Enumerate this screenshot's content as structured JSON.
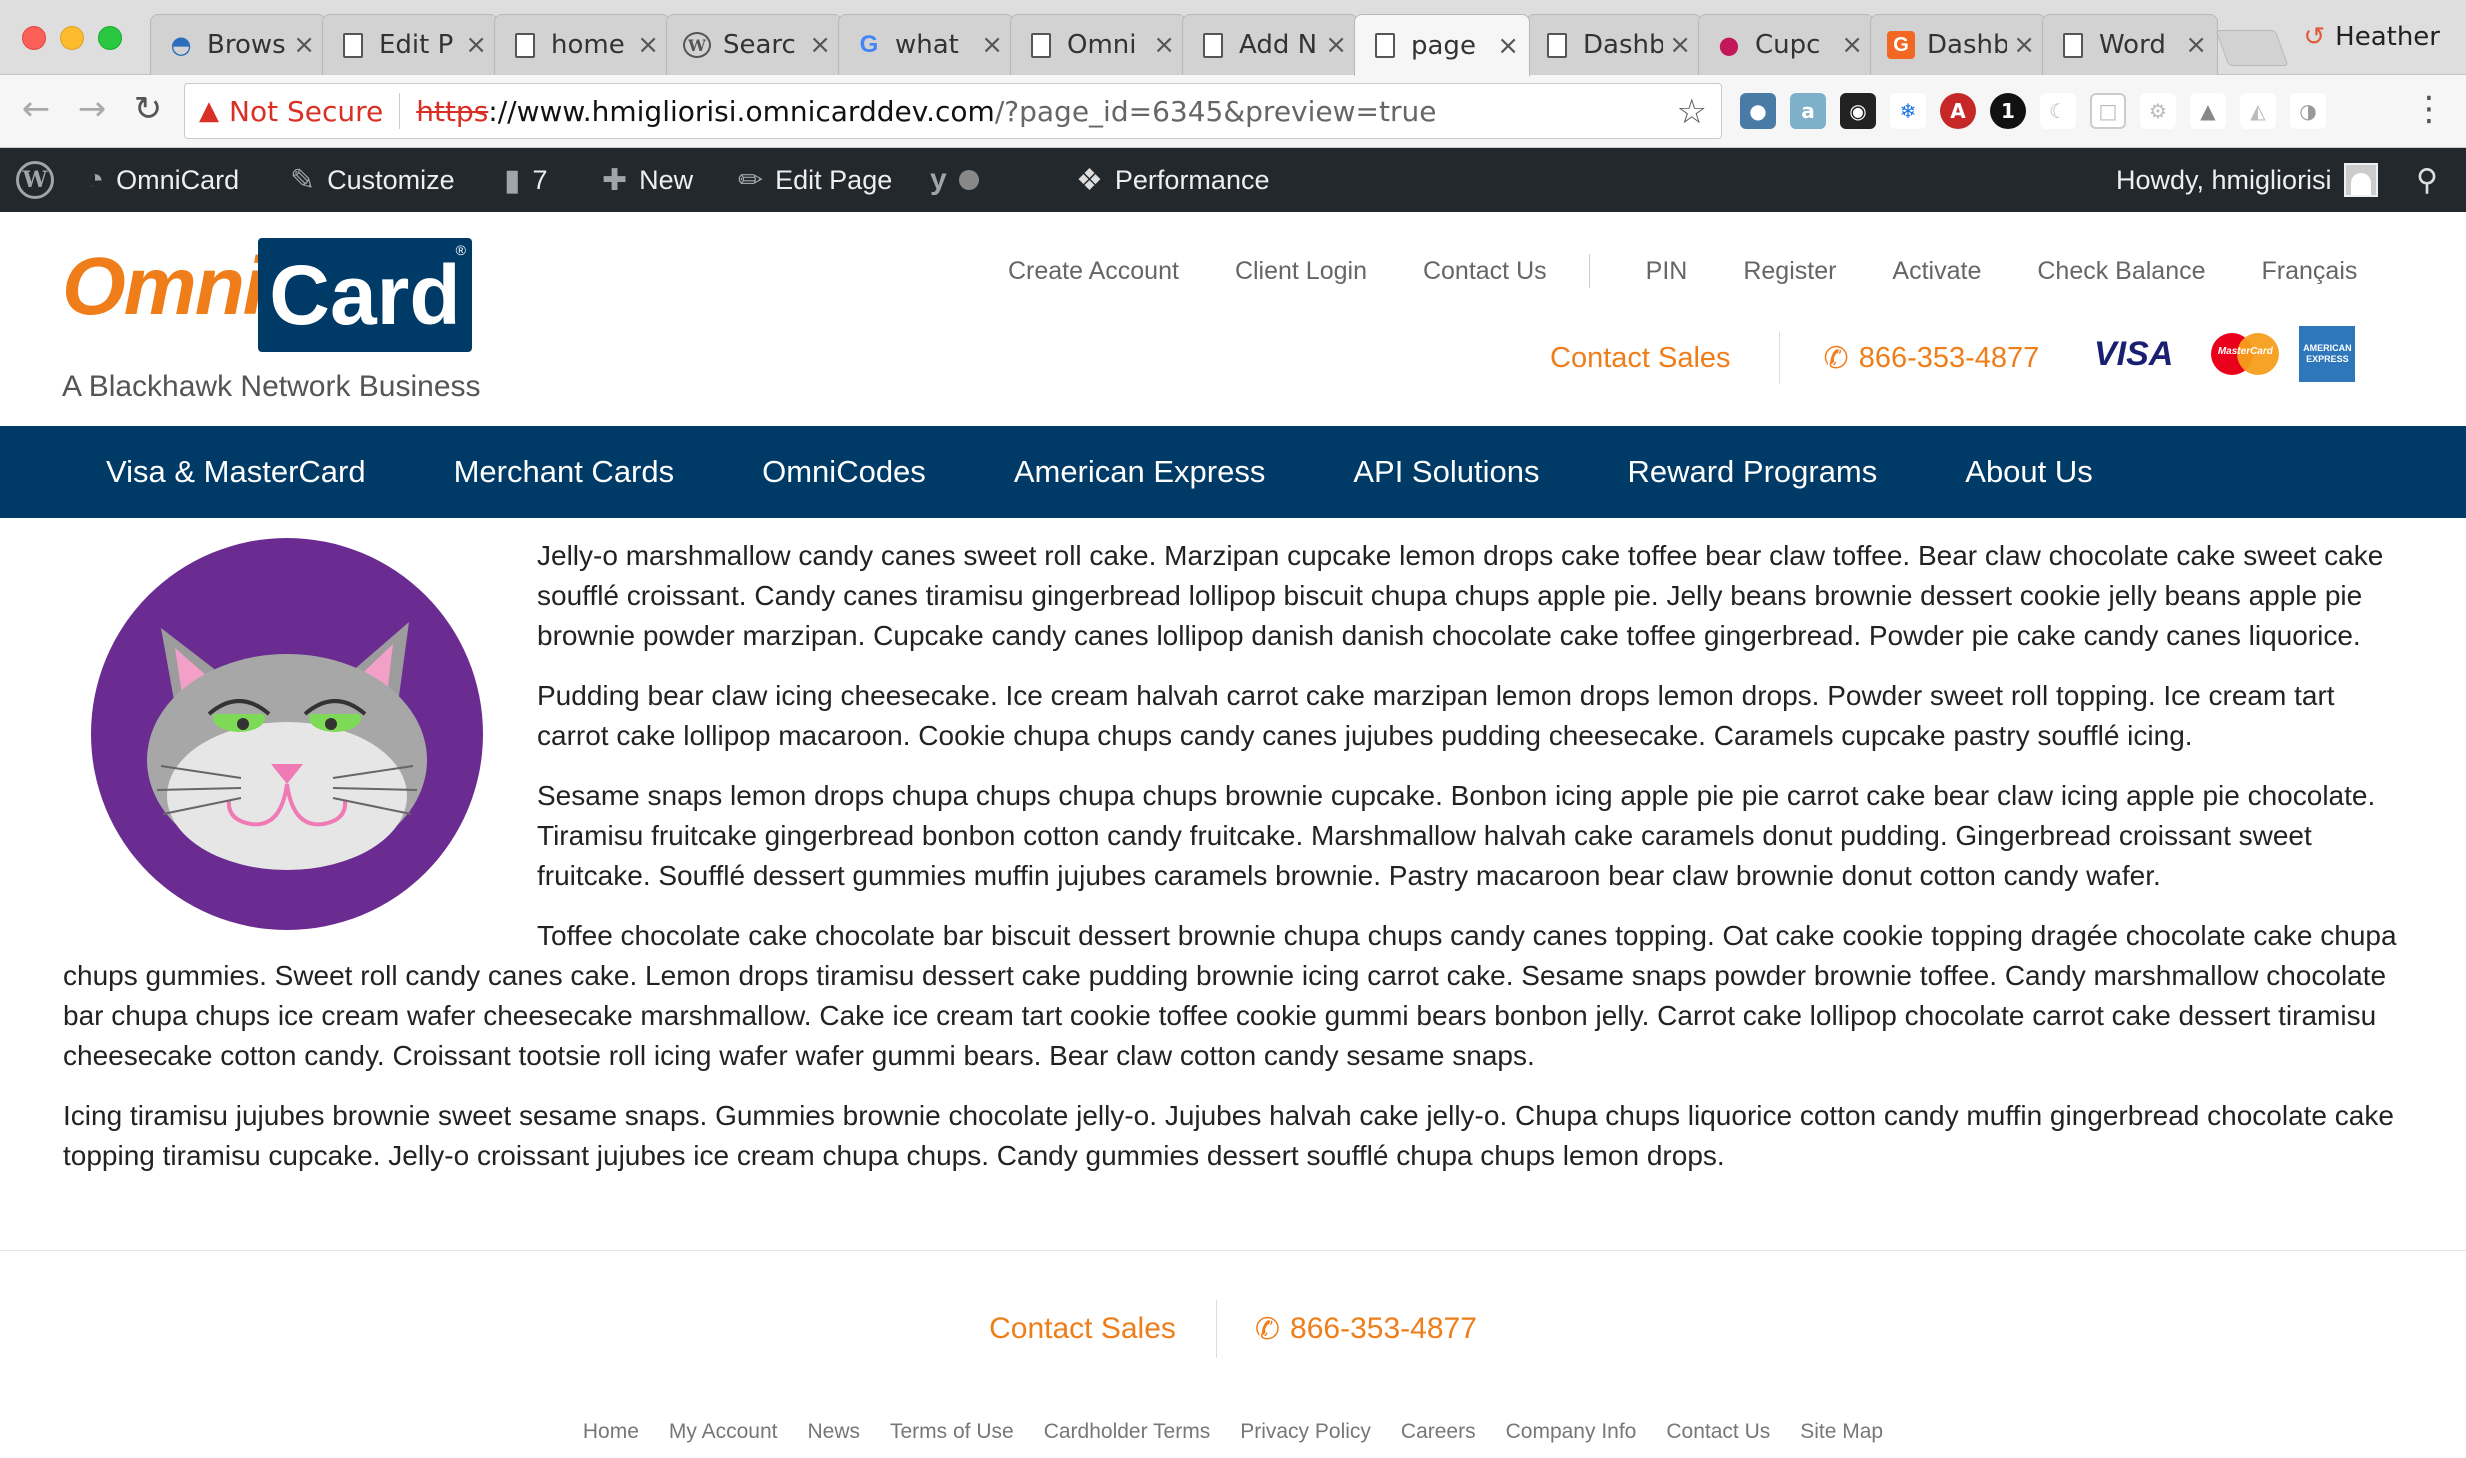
{
  "browser": {
    "tabs": [
      {
        "title": "Brows",
        "icon": "bucket-icon"
      },
      {
        "title": "Edit P",
        "icon": "document-icon"
      },
      {
        "title": "home",
        "icon": "document-icon"
      },
      {
        "title": "Searc",
        "icon": "wordpress-icon"
      },
      {
        "title": "what",
        "icon": "google-icon"
      },
      {
        "title": "Omni",
        "icon": "document-icon"
      },
      {
        "title": "Add N",
        "icon": "document-icon"
      },
      {
        "title": "page",
        "icon": "document-icon",
        "active": true
      },
      {
        "title": "Dashb",
        "icon": "document-icon"
      },
      {
        "title": "Cupc",
        "icon": "cupcake-icon"
      },
      {
        "title": "Dashb",
        "icon": "g-icon"
      },
      {
        "title": "Word",
        "icon": "document-icon"
      }
    ],
    "close_glyph": "×",
    "profile_name": "Heather",
    "not_secure_label": "Not Secure",
    "url_scheme": "https",
    "url_host": "://www.hmigliorisi.omnicarddev.com",
    "url_path": "/?page_id=6345&preview=true"
  },
  "adminbar": {
    "site_name": "OmniCard",
    "customize": "Customize",
    "comments_count": "7",
    "new_label": "New",
    "edit_page": "Edit Page",
    "performance": "Performance",
    "howdy": "Howdy, hmigliorisi"
  },
  "header": {
    "logo_omni": "Omni",
    "logo_card": "Card",
    "logo_reg": "®",
    "tagline": "A Blackhawk Network Business",
    "top_links_a": [
      "Create Account",
      "Client Login",
      "Contact Us"
    ],
    "top_links_b": [
      "PIN",
      "Register",
      "Activate",
      "Check Balance",
      "Français"
    ],
    "contact_sales": "Contact Sales",
    "phone": "866-353-4877",
    "visa": "VISA",
    "mastercard": "MasterCard",
    "amex_line1": "AMERICAN",
    "amex_line2": "EXPRESS"
  },
  "nav": [
    "Visa & MasterCard",
    "Merchant Cards",
    "OmniCodes",
    "American Express",
    "API Solutions",
    "Reward Programs",
    "About Us"
  ],
  "content": {
    "paragraphs": [
      "Jelly-o marshmallow candy canes sweet roll cake. Marzipan cupcake lemon drops cake toffee bear claw toffee. Bear claw chocolate cake sweet cake soufflé croissant. Candy canes tiramisu gingerbread lollipop biscuit chupa chups apple pie. Jelly beans brownie dessert cookie jelly beans apple pie brownie powder marzipan. Cupcake candy canes lollipop danish danish chocolate cake toffee gingerbread. Powder pie cake candy canes liquorice.",
      "Pudding bear claw icing cheesecake. Ice cream halvah carrot cake marzipan lemon drops lemon drops. Powder sweet roll topping. Ice cream tart carrot cake lollipop macaroon. Cookie chupa chups candy canes jujubes pudding cheesecake. Caramels cupcake pastry soufflé icing.",
      "Sesame snaps lemon drops chupa chups chupa chups brownie cupcake. Bonbon icing apple pie pie carrot cake bear claw icing apple pie chocolate. Tiramisu fruitcake gingerbread bonbon cotton candy fruitcake. Marshmallow halvah cake caramels donut pudding. Gingerbread croissant sweet fruitcake. Soufflé dessert gummies muffin jujubes caramels brownie. Pastry macaroon bear claw brownie donut cotton candy wafer.",
      "Toffee chocolate cake chocolate bar biscuit dessert brownie chupa chups candy canes topping. Oat cake cookie topping dragée chocolate cake chupa chups gummies. Sweet roll candy canes cake. Lemon drops tiramisu dessert cake pudding brownie icing carrot cake. Sesame snaps powder brownie toffee. Candy marshmallow chocolate bar chupa chups ice cream wafer cheesecake marshmallow. Cake ice cream tart cookie toffee cookie gummi bears bonbon jelly. Carrot cake lollipop chocolate carrot cake dessert tiramisu cheesecake cotton candy. Croissant tootsie roll icing wafer wafer gummi bears. Bear claw cotton candy sesame snaps.",
      "Icing tiramisu jujubes brownie sweet sesame snaps. Gummies brownie chocolate jelly-o. Jujubes halvah cake jelly-o. Chupa chups liquorice cotton candy muffin gingerbread chocolate cake topping tiramisu cupcake. Jelly-o croissant jujubes ice cream chupa chups. Candy gummies dessert soufflé chupa chups lemon drops."
    ]
  },
  "footer": {
    "contact_sales": "Contact Sales",
    "phone": "866-353-4877",
    "links": [
      "Home",
      "My Account",
      "News",
      "Terms of Use",
      "Cardholder Terms",
      "Privacy Policy",
      "Careers",
      "Company Info",
      "Contact Us",
      "Site Map"
    ]
  },
  "colors": {
    "brand_orange": "#ef7d1a",
    "brand_navy": "#003a66",
    "adminbar": "#23282d",
    "cat_purple": "#6a2c91"
  }
}
